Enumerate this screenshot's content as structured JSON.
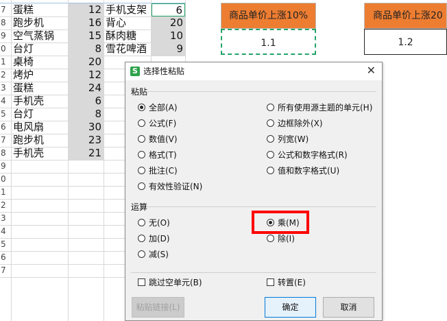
{
  "sheet": {
    "row_numbers": [
      "7",
      "8",
      "9",
      "0",
      "1",
      "2",
      "3",
      "4",
      "5",
      "6",
      "7",
      "8",
      "9",
      "0",
      "1",
      "2",
      "3",
      "4",
      "5",
      "6",
      "7"
    ],
    "col_a_partial_header": "蛋糕",
    "list1_names": [
      "蛋糕",
      "跑步机",
      "空气蒸锅",
      "台灯",
      "桌椅",
      "烤炉",
      "蛋糕",
      "手机壳",
      "台灯",
      "电风扇",
      "跑步机",
      "手机壳"
    ],
    "list1_values": [
      "12",
      "16",
      "15",
      "8",
      "20",
      "12",
      "24",
      "6",
      "8",
      "30",
      "23",
      "21"
    ],
    "list2_names": [
      "手机支架",
      "背心",
      "酥肉糖",
      "雪花啤酒"
    ],
    "list2_values": [
      "6",
      "20",
      "10",
      "9"
    ],
    "header1": "商品单价上涨10%",
    "header2": "商品单价上涨20",
    "value1": "1.1",
    "value2": "1.2"
  },
  "dialog": {
    "title": "选择性粘贴",
    "close_icon": "close-icon",
    "paste_section": "粘贴",
    "paste_options_left": [
      "全部(A)",
      "公式(F)",
      "数值(V)",
      "格式(T)",
      "批注(C)",
      "有效性验证(N)"
    ],
    "paste_options_right": [
      "所有使用源主题的单元(H)",
      "边框除外(X)",
      "列宽(W)",
      "公式和数字格式(R)",
      "值和数字格式(U)"
    ],
    "paste_selected": "全部(A)",
    "operation_section": "运算",
    "operation_left": [
      "无(O)",
      "加(D)",
      "减(S)"
    ],
    "operation_right": [
      "乘(M)",
      "除(I)"
    ],
    "operation_selected": "乘(M)",
    "skip_blanks": "跳过空单元(B)",
    "transpose": "转置(E)",
    "paste_link_button": "粘贴链接(L)",
    "ok_button": "确定",
    "cancel_button": "取消"
  },
  "colors": {
    "orange_header": "#ed7d31",
    "highlight_red": "#ff0000",
    "selection_green": "#21a366",
    "app_icon_green": "#2ea24a"
  }
}
